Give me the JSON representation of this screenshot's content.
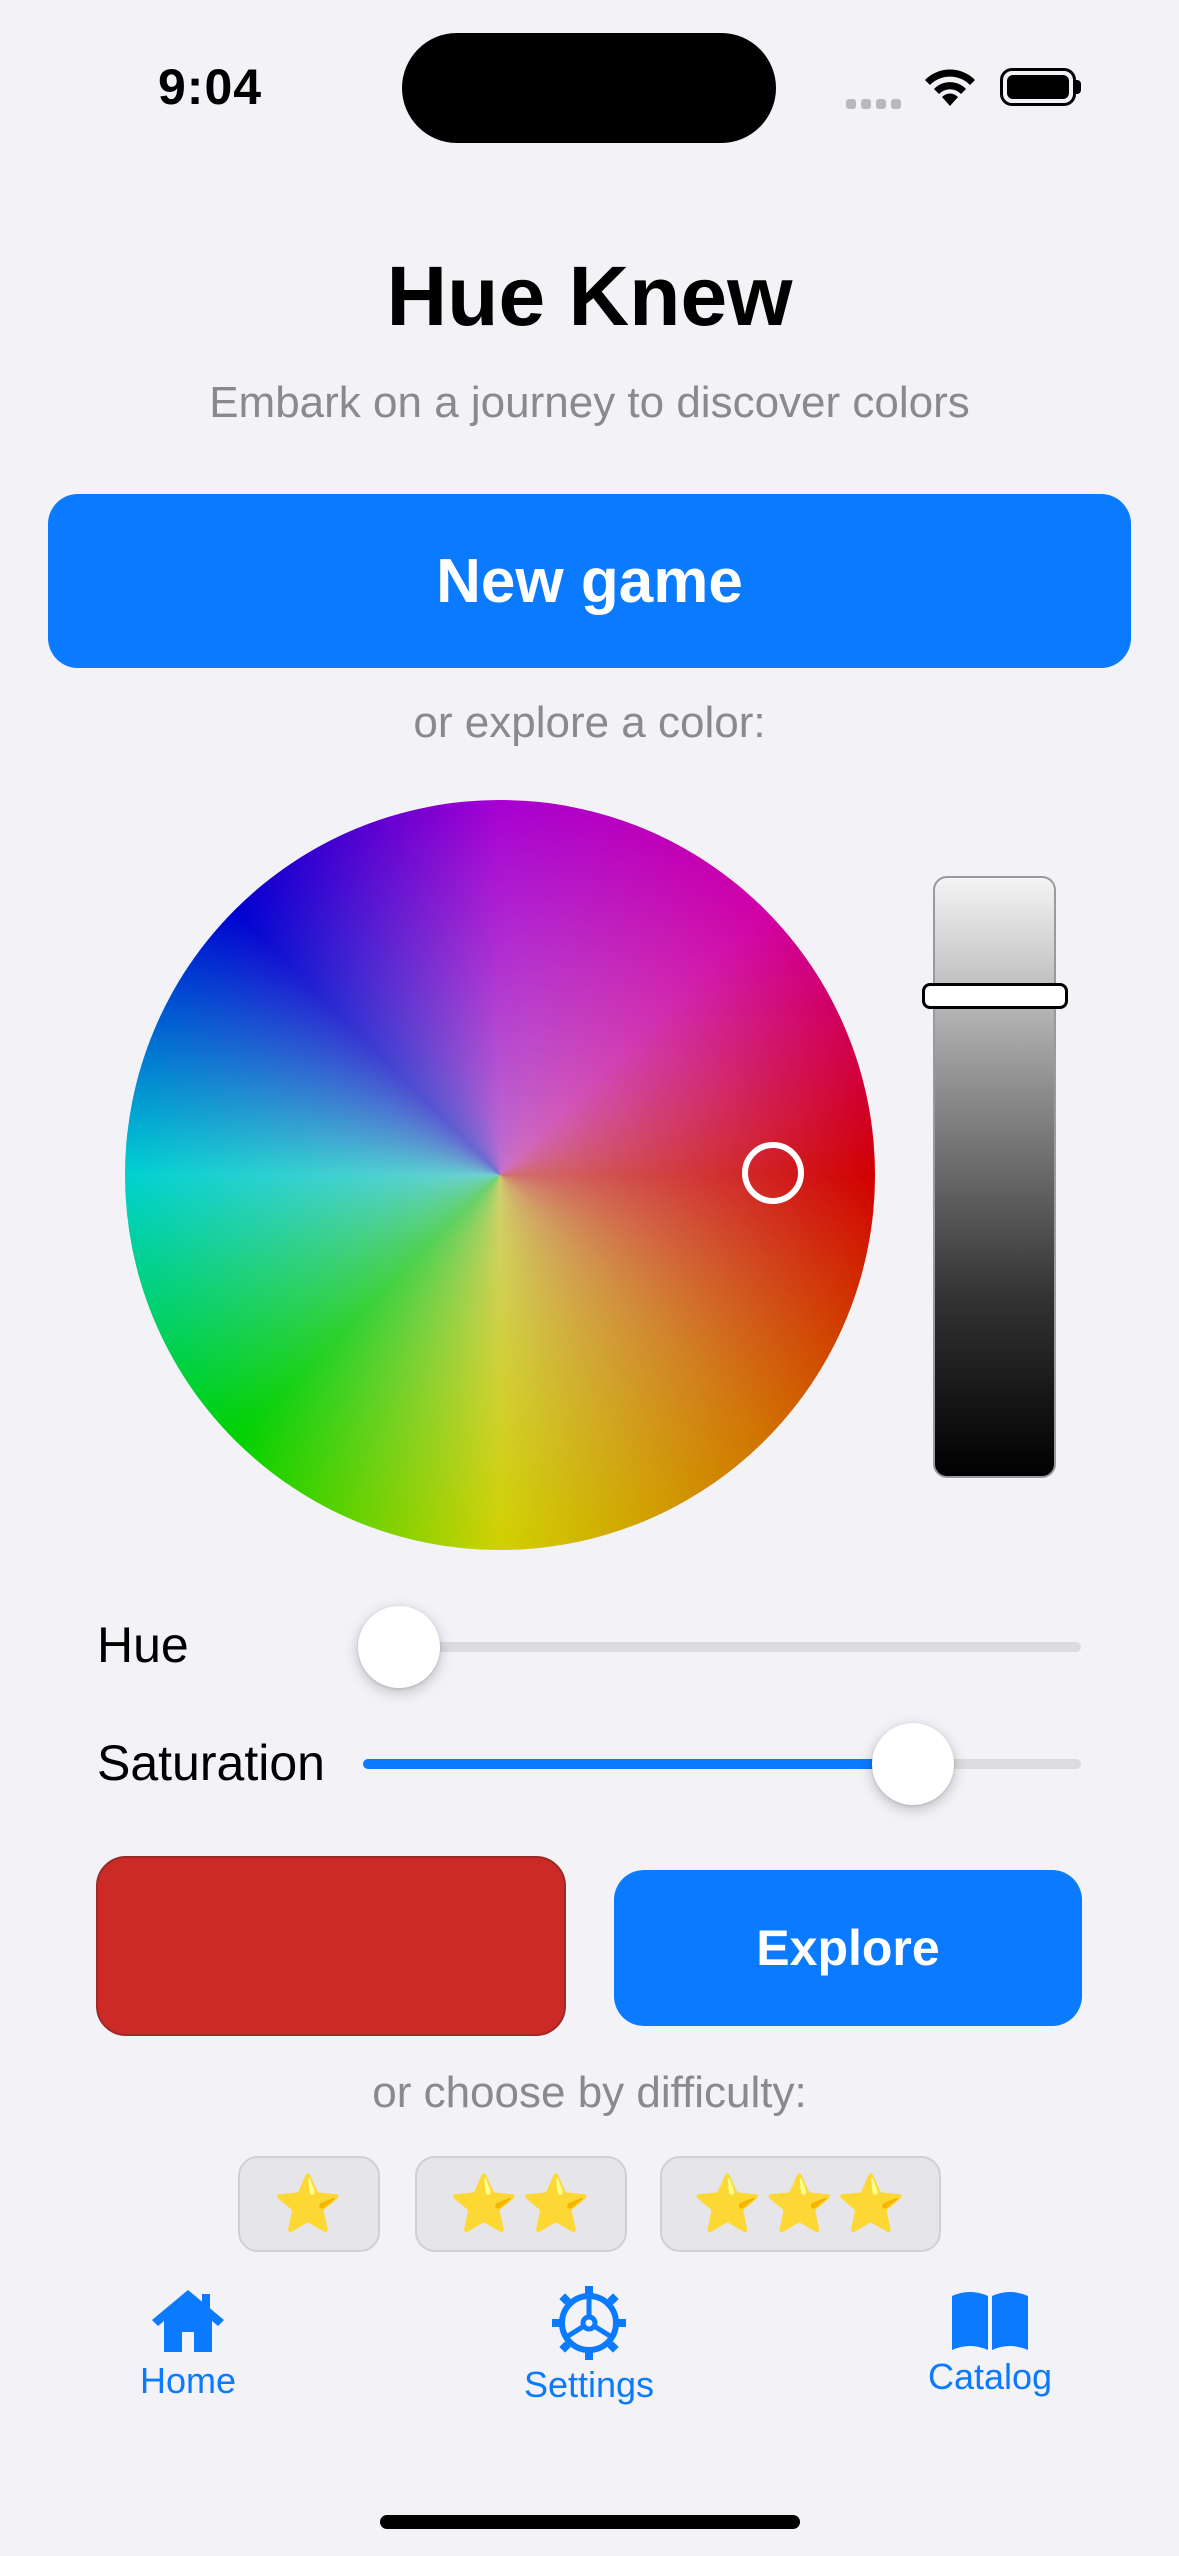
{
  "status_bar": {
    "time": "9:04"
  },
  "header": {
    "title": "Hue Knew",
    "subtitle": "Embark on a journey to discover colors"
  },
  "new_game_label": "New game",
  "explore_hint": "or explore a color:",
  "picker": {
    "brightness_level": 0.2,
    "selected_color": "#cc2a27"
  },
  "sliders": {
    "hue_label": "Hue",
    "hue_value": 0.0,
    "saturation_label": "Saturation",
    "saturation_value": 0.77
  },
  "explore_label": "Explore",
  "difficulty_hint": "or choose by difficulty:",
  "difficulty": [
    {
      "stars": "⭐"
    },
    {
      "stars": "⭐⭐"
    },
    {
      "stars": "⭐⭐⭐"
    }
  ],
  "tabs": [
    {
      "label": "Home",
      "icon": "house-icon",
      "selected": true
    },
    {
      "label": "Settings",
      "icon": "gear-icon",
      "selected": false
    },
    {
      "label": "Catalog",
      "icon": "book-icon",
      "selected": false
    }
  ],
  "colors": {
    "accent": "#0a7aff",
    "background": "#f2f2f7"
  }
}
